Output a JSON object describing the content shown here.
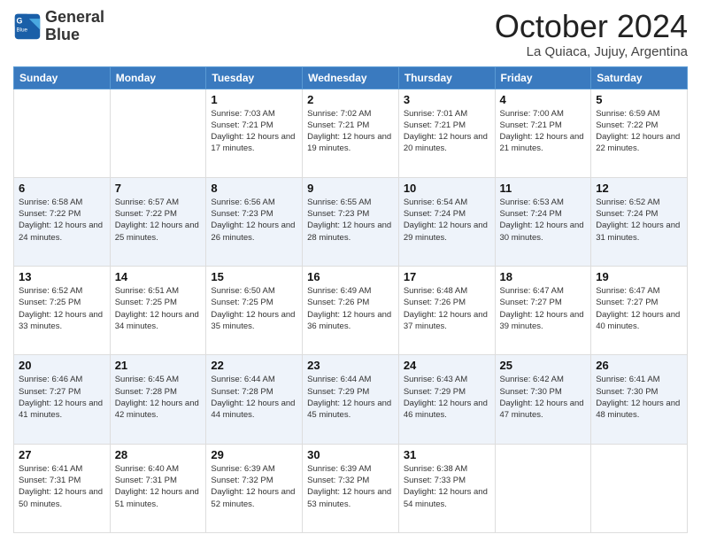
{
  "logo": {
    "line1": "General",
    "line2": "Blue"
  },
  "header": {
    "month": "October 2024",
    "location": "La Quiaca, Jujuy, Argentina"
  },
  "weekdays": [
    "Sunday",
    "Monday",
    "Tuesday",
    "Wednesday",
    "Thursday",
    "Friday",
    "Saturday"
  ],
  "weeks": [
    [
      {
        "num": "",
        "sunrise": "",
        "sunset": "",
        "daylight": ""
      },
      {
        "num": "",
        "sunrise": "",
        "sunset": "",
        "daylight": ""
      },
      {
        "num": "1",
        "sunrise": "Sunrise: 7:03 AM",
        "sunset": "Sunset: 7:21 PM",
        "daylight": "Daylight: 12 hours and 17 minutes."
      },
      {
        "num": "2",
        "sunrise": "Sunrise: 7:02 AM",
        "sunset": "Sunset: 7:21 PM",
        "daylight": "Daylight: 12 hours and 19 minutes."
      },
      {
        "num": "3",
        "sunrise": "Sunrise: 7:01 AM",
        "sunset": "Sunset: 7:21 PM",
        "daylight": "Daylight: 12 hours and 20 minutes."
      },
      {
        "num": "4",
        "sunrise": "Sunrise: 7:00 AM",
        "sunset": "Sunset: 7:21 PM",
        "daylight": "Daylight: 12 hours and 21 minutes."
      },
      {
        "num": "5",
        "sunrise": "Sunrise: 6:59 AM",
        "sunset": "Sunset: 7:22 PM",
        "daylight": "Daylight: 12 hours and 22 minutes."
      }
    ],
    [
      {
        "num": "6",
        "sunrise": "Sunrise: 6:58 AM",
        "sunset": "Sunset: 7:22 PM",
        "daylight": "Daylight: 12 hours and 24 minutes."
      },
      {
        "num": "7",
        "sunrise": "Sunrise: 6:57 AM",
        "sunset": "Sunset: 7:22 PM",
        "daylight": "Daylight: 12 hours and 25 minutes."
      },
      {
        "num": "8",
        "sunrise": "Sunrise: 6:56 AM",
        "sunset": "Sunset: 7:23 PM",
        "daylight": "Daylight: 12 hours and 26 minutes."
      },
      {
        "num": "9",
        "sunrise": "Sunrise: 6:55 AM",
        "sunset": "Sunset: 7:23 PM",
        "daylight": "Daylight: 12 hours and 28 minutes."
      },
      {
        "num": "10",
        "sunrise": "Sunrise: 6:54 AM",
        "sunset": "Sunset: 7:24 PM",
        "daylight": "Daylight: 12 hours and 29 minutes."
      },
      {
        "num": "11",
        "sunrise": "Sunrise: 6:53 AM",
        "sunset": "Sunset: 7:24 PM",
        "daylight": "Daylight: 12 hours and 30 minutes."
      },
      {
        "num": "12",
        "sunrise": "Sunrise: 6:52 AM",
        "sunset": "Sunset: 7:24 PM",
        "daylight": "Daylight: 12 hours and 31 minutes."
      }
    ],
    [
      {
        "num": "13",
        "sunrise": "Sunrise: 6:52 AM",
        "sunset": "Sunset: 7:25 PM",
        "daylight": "Daylight: 12 hours and 33 minutes."
      },
      {
        "num": "14",
        "sunrise": "Sunrise: 6:51 AM",
        "sunset": "Sunset: 7:25 PM",
        "daylight": "Daylight: 12 hours and 34 minutes."
      },
      {
        "num": "15",
        "sunrise": "Sunrise: 6:50 AM",
        "sunset": "Sunset: 7:25 PM",
        "daylight": "Daylight: 12 hours and 35 minutes."
      },
      {
        "num": "16",
        "sunrise": "Sunrise: 6:49 AM",
        "sunset": "Sunset: 7:26 PM",
        "daylight": "Daylight: 12 hours and 36 minutes."
      },
      {
        "num": "17",
        "sunrise": "Sunrise: 6:48 AM",
        "sunset": "Sunset: 7:26 PM",
        "daylight": "Daylight: 12 hours and 37 minutes."
      },
      {
        "num": "18",
        "sunrise": "Sunrise: 6:47 AM",
        "sunset": "Sunset: 7:27 PM",
        "daylight": "Daylight: 12 hours and 39 minutes."
      },
      {
        "num": "19",
        "sunrise": "Sunrise: 6:47 AM",
        "sunset": "Sunset: 7:27 PM",
        "daylight": "Daylight: 12 hours and 40 minutes."
      }
    ],
    [
      {
        "num": "20",
        "sunrise": "Sunrise: 6:46 AM",
        "sunset": "Sunset: 7:27 PM",
        "daylight": "Daylight: 12 hours and 41 minutes."
      },
      {
        "num": "21",
        "sunrise": "Sunrise: 6:45 AM",
        "sunset": "Sunset: 7:28 PM",
        "daylight": "Daylight: 12 hours and 42 minutes."
      },
      {
        "num": "22",
        "sunrise": "Sunrise: 6:44 AM",
        "sunset": "Sunset: 7:28 PM",
        "daylight": "Daylight: 12 hours and 44 minutes."
      },
      {
        "num": "23",
        "sunrise": "Sunrise: 6:44 AM",
        "sunset": "Sunset: 7:29 PM",
        "daylight": "Daylight: 12 hours and 45 minutes."
      },
      {
        "num": "24",
        "sunrise": "Sunrise: 6:43 AM",
        "sunset": "Sunset: 7:29 PM",
        "daylight": "Daylight: 12 hours and 46 minutes."
      },
      {
        "num": "25",
        "sunrise": "Sunrise: 6:42 AM",
        "sunset": "Sunset: 7:30 PM",
        "daylight": "Daylight: 12 hours and 47 minutes."
      },
      {
        "num": "26",
        "sunrise": "Sunrise: 6:41 AM",
        "sunset": "Sunset: 7:30 PM",
        "daylight": "Daylight: 12 hours and 48 minutes."
      }
    ],
    [
      {
        "num": "27",
        "sunrise": "Sunrise: 6:41 AM",
        "sunset": "Sunset: 7:31 PM",
        "daylight": "Daylight: 12 hours and 50 minutes."
      },
      {
        "num": "28",
        "sunrise": "Sunrise: 6:40 AM",
        "sunset": "Sunset: 7:31 PM",
        "daylight": "Daylight: 12 hours and 51 minutes."
      },
      {
        "num": "29",
        "sunrise": "Sunrise: 6:39 AM",
        "sunset": "Sunset: 7:32 PM",
        "daylight": "Daylight: 12 hours and 52 minutes."
      },
      {
        "num": "30",
        "sunrise": "Sunrise: 6:39 AM",
        "sunset": "Sunset: 7:32 PM",
        "daylight": "Daylight: 12 hours and 53 minutes."
      },
      {
        "num": "31",
        "sunrise": "Sunrise: 6:38 AM",
        "sunset": "Sunset: 7:33 PM",
        "daylight": "Daylight: 12 hours and 54 minutes."
      },
      {
        "num": "",
        "sunrise": "",
        "sunset": "",
        "daylight": ""
      },
      {
        "num": "",
        "sunrise": "",
        "sunset": "",
        "daylight": ""
      }
    ]
  ]
}
